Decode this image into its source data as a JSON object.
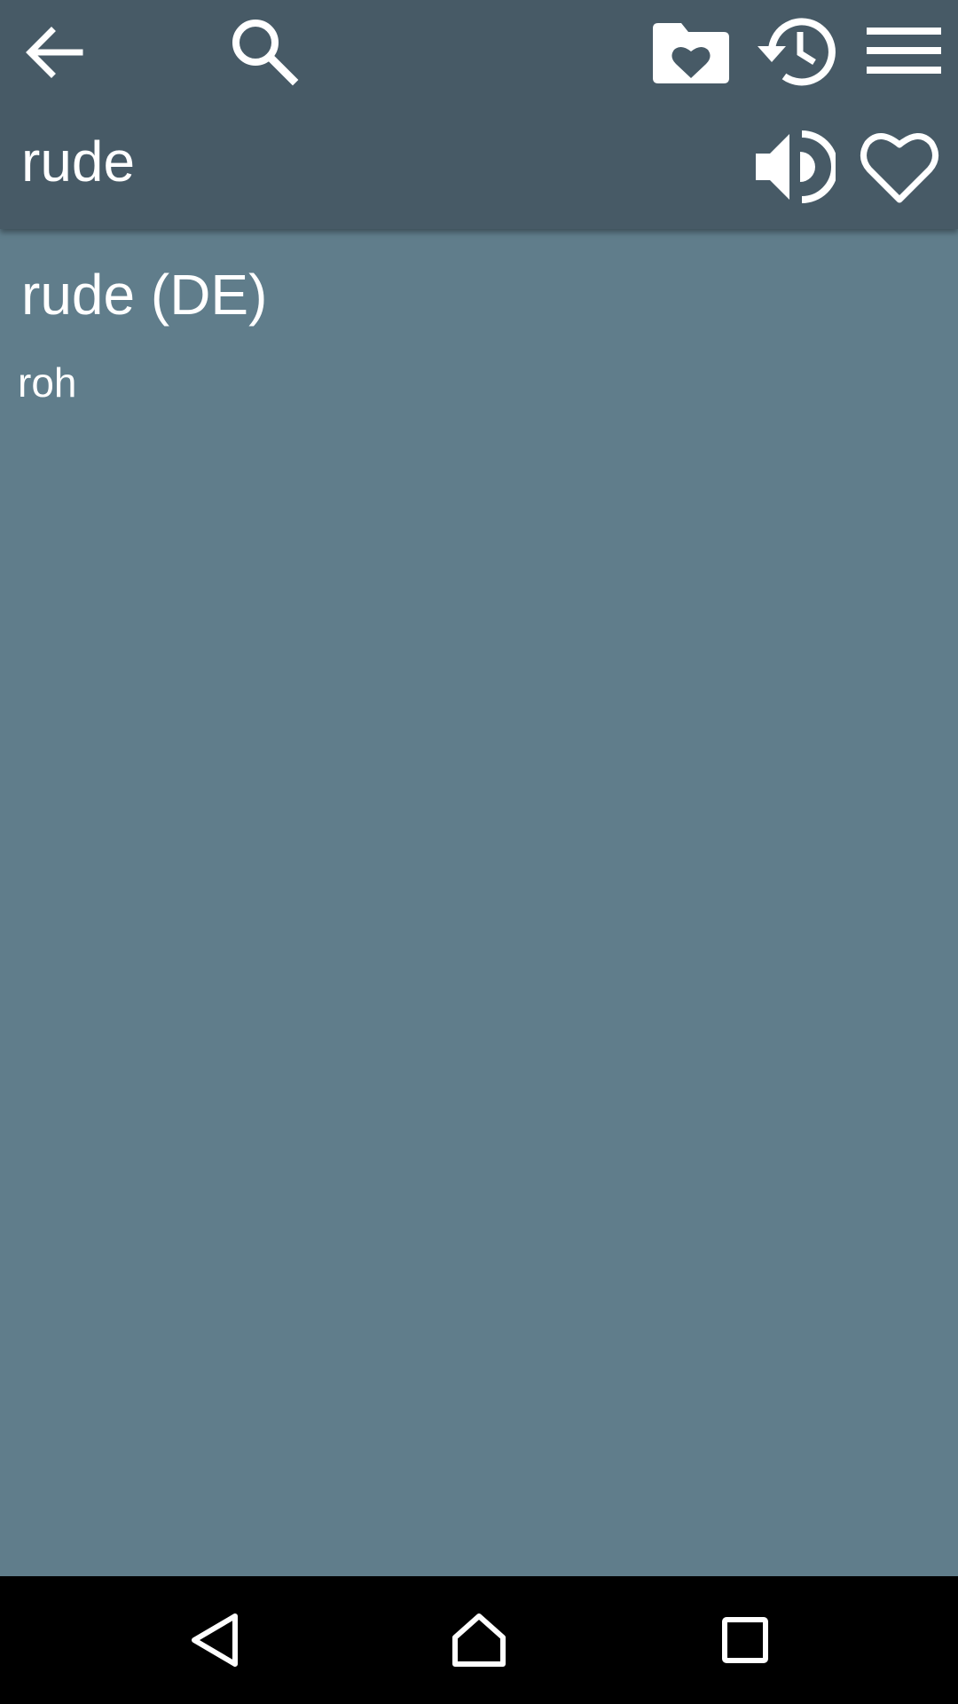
{
  "header": {
    "word": "rude",
    "icons": [
      "back-arrow-icon",
      "search-icon",
      "favorites-folder-icon",
      "history-icon",
      "menu-icon",
      "speaker-icon",
      "heart-outline-icon"
    ]
  },
  "entry": {
    "heading": "rude (DE)",
    "translation": "roh"
  },
  "navbar": {
    "icons": [
      "nav-back-icon",
      "nav-home-icon",
      "nav-recents-icon"
    ]
  },
  "colors": {
    "header_bg": "#475a66",
    "content_bg": "#607d8b",
    "navbar_bg": "#000000",
    "text": "#ffffff"
  }
}
